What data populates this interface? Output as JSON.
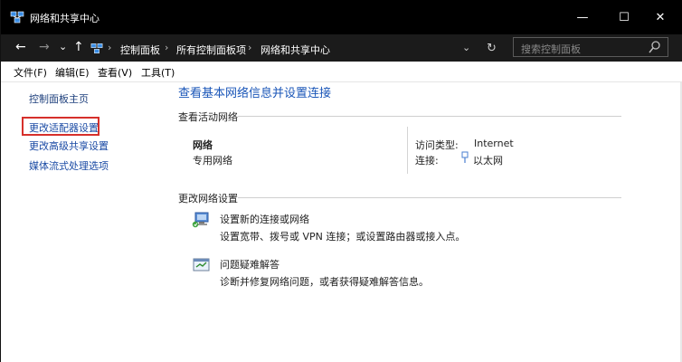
{
  "window": {
    "title": "网络和共享中心",
    "minimize": "—",
    "maximize": "☐",
    "close": "✕"
  },
  "nav": {
    "back": "←",
    "forward": "→",
    "recent": "⌄",
    "up": "↑"
  },
  "address": {
    "crumbs": [
      "控制面板",
      "所有控制面板项",
      "网络和共享中心"
    ],
    "separator": "›",
    "dropdown": "⌄",
    "refresh": "↻"
  },
  "search": {
    "placeholder": "搜索控制面板"
  },
  "menu": [
    "文件(F)",
    "编辑(E)",
    "查看(V)",
    "工具(T)"
  ],
  "sidebar": {
    "items": [
      {
        "label": "控制面板主页"
      },
      {
        "label": "更改适配器设置"
      },
      {
        "label": "更改高级共享设置"
      },
      {
        "label": "媒体流式处理选项"
      }
    ]
  },
  "main": {
    "heading": "查看基本网络信息并设置连接",
    "active_section": "查看活动网络",
    "network_name": "网络",
    "network_type": "专用网络",
    "access_type_label": "访问类型:",
    "access_type_value": "Internet",
    "connections_label": "连接:",
    "connections_value": "以太网",
    "change_section": "更改网络设置",
    "tasks": [
      {
        "title": "设置新的连接或网络",
        "desc": "设置宽带、拨号或 VPN 连接；或设置路由器或接入点。",
        "icon": "network-setup-icon"
      },
      {
        "title": "问题疑难解答",
        "desc": "诊断并修复网络问题，或者获得疑难解答信息。",
        "icon": "troubleshoot-icon"
      }
    ]
  },
  "colors": {
    "titlebar": "#000000",
    "link": "#1a56b8",
    "highlight_border": "#d6302b"
  }
}
